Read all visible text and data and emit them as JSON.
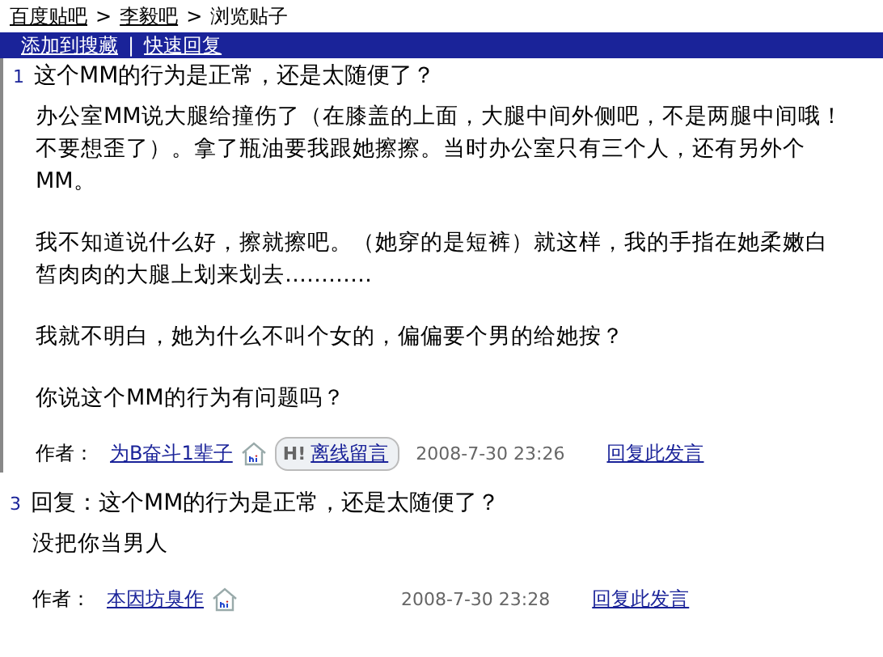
{
  "breadcrumb": [
    "百度贴吧",
    "李毅吧",
    "浏览贴子"
  ],
  "breadcrumb_separator": ">",
  "actions": [
    "添加到搜藏",
    "快速回复"
  ],
  "action_separator": "|",
  "posts": [
    {
      "floor": "1",
      "title": "这个MM的行为是正常，还是太随便了？",
      "paragraphs": [
        "办公室MM说大腿给撞伤了（在膝盖的上面，大腿中间外侧吧，不是两腿中间哦！不要想歪了）。拿了瓶油要我跟她擦擦。当时办公室只有三个人，还有另外个MM。",
        "我不知道说什么好，擦就擦吧。（她穿的是短裤）就这样，我的手指在她柔嫩白皙肉肉的大腿上划来划去…………",
        "我就不明白，她为什么不叫个女的，偏偏要个男的给她按？",
        "你说这个MM的行为有问题吗？"
      ],
      "author_label": "作者：",
      "author": "为B奋斗1辈子",
      "message_badge": "H!",
      "message_button": "离线留言",
      "time": "2008-7-30 23:26",
      "reply": "回复此发言"
    },
    {
      "floor": "3",
      "title": "回复：这个MM的行为是正常，还是太随便了？",
      "paragraphs": [
        "没把你当男人"
      ],
      "author_label": "作者：",
      "author": "本因坊臭作",
      "time": "2008-7-30 23:28",
      "reply": "回复此发言"
    }
  ]
}
